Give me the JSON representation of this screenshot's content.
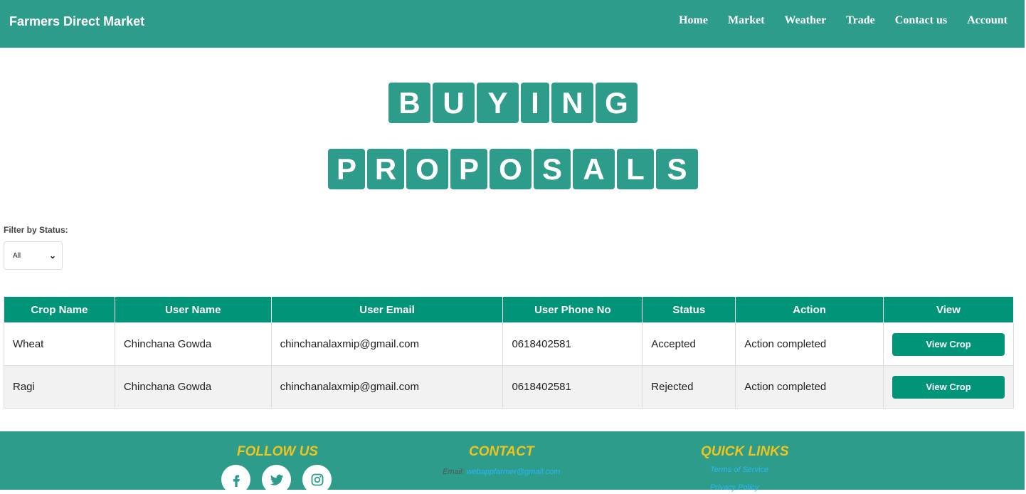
{
  "header": {
    "brand": "Farmers Direct Market",
    "nav": [
      "Home",
      "Market",
      "Weather",
      "Trade",
      "Contact us",
      "Account"
    ]
  },
  "title": {
    "line1": [
      "B",
      "U",
      "Y",
      "I",
      "N",
      "G"
    ],
    "line2": [
      "P",
      "R",
      "O",
      "P",
      "O",
      "S",
      "A",
      "L",
      "S"
    ]
  },
  "filter": {
    "label": "Filter by Status:",
    "selected": "All"
  },
  "table": {
    "headers": [
      "Crop Name",
      "User Name",
      "User Email",
      "User Phone No",
      "Status",
      "Action",
      "View"
    ],
    "rows": [
      {
        "crop": "Wheat",
        "user": "Chinchana Gowda",
        "email": "chinchanalaxmip@gmail.com",
        "phone": "0618402581",
        "status": "Accepted",
        "action": "Action completed",
        "button": "View Crop"
      },
      {
        "crop": "Ragi",
        "user": "Chinchana Gowda",
        "email": "chinchanalaxmip@gmail.com",
        "phone": "0618402581",
        "status": "Rejected",
        "action": "Action completed",
        "button": "View Crop"
      }
    ]
  },
  "footer": {
    "follow_title": "FOLLOW US",
    "contact_title": "CONTACT",
    "quick_title": "QUICK LINKS",
    "email_label": "Email:",
    "email_value": "webappfarmer@gmail.com",
    "links": [
      "Terms of Service",
      "Privacy Policy"
    ],
    "social_icons": [
      "facebook-icon",
      "twitter-icon",
      "instagram-icon"
    ],
    "accent_color": "#f0c419",
    "brand_color": "#2e9c8b"
  }
}
